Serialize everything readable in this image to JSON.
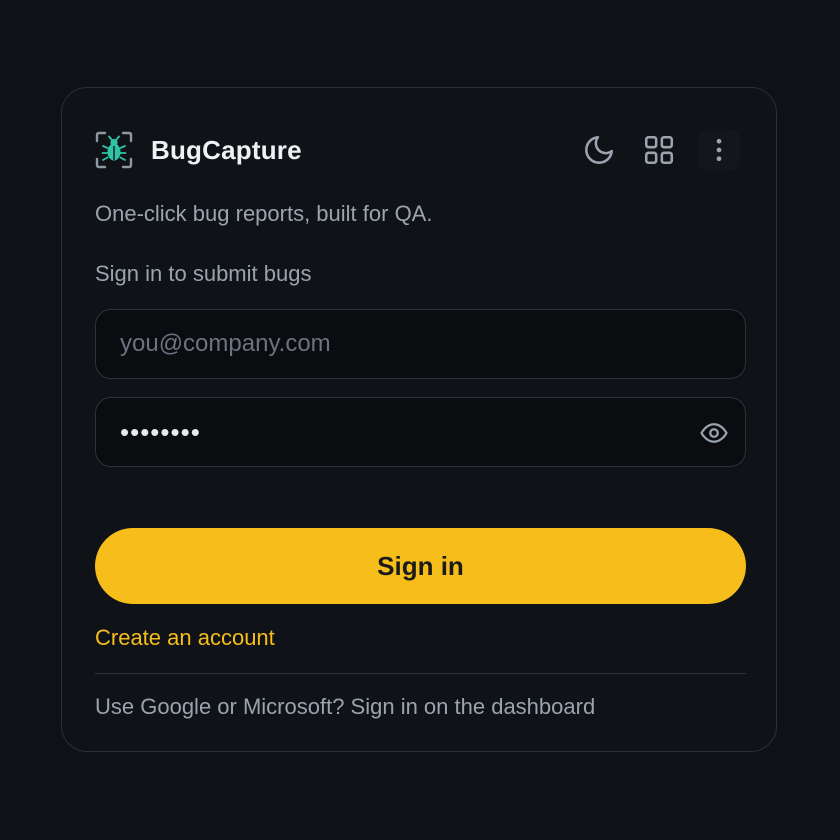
{
  "app": {
    "name": "BugCapture",
    "tagline": "One-click bug reports, built for QA.",
    "logo_icon": "bug-icon",
    "accent_color": "#f7bd1a",
    "logo_color": "#2ec4a6"
  },
  "header": {
    "actions": [
      {
        "name": "theme-toggle",
        "icon": "moon-icon"
      },
      {
        "name": "apps-menu",
        "icon": "grid-icon"
      },
      {
        "name": "more-menu",
        "icon": "more-vertical-icon"
      }
    ]
  },
  "form": {
    "heading": "Sign in to submit bugs",
    "email": {
      "placeholder": "you@company.com",
      "value": ""
    },
    "password": {
      "value": "••••••••",
      "reveal_icon": "eye-icon"
    },
    "submit_label": "Sign in"
  },
  "links": {
    "create_account": "Create an account"
  },
  "footer": {
    "text": "Use Google or Microsoft? Sign in on the dashboard"
  }
}
